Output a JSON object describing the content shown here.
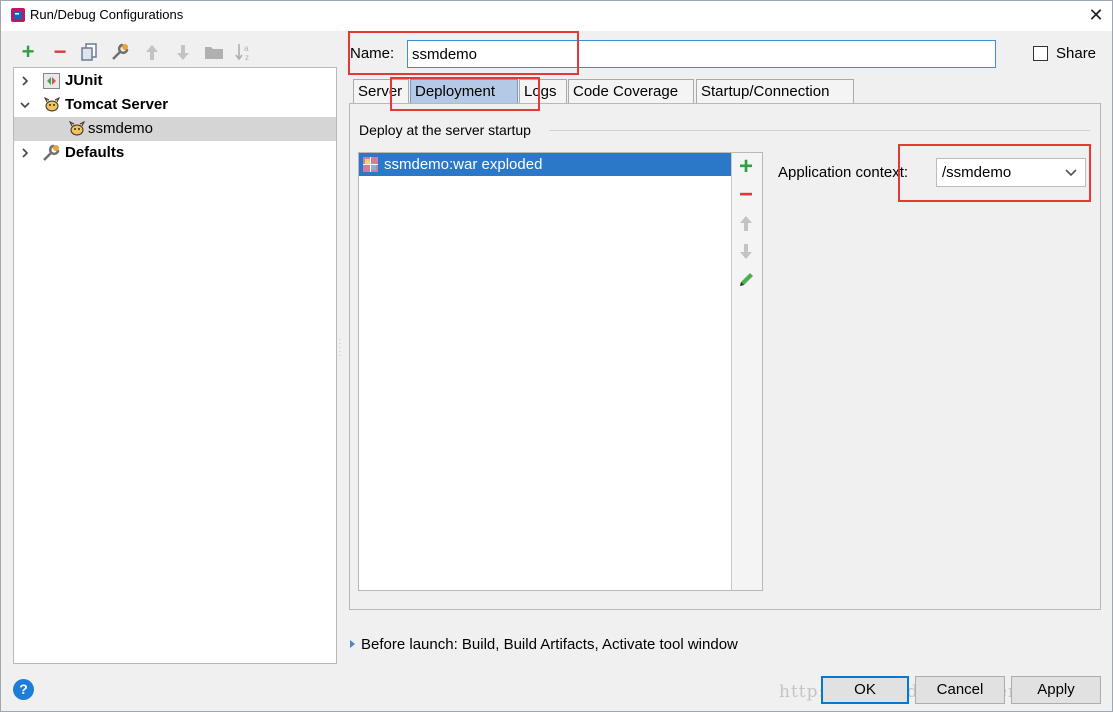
{
  "window": {
    "title": "Run/Debug Configurations",
    "close_glyph": "✕"
  },
  "toolbar": {
    "buttons": [
      {
        "name": "add-icon",
        "glyph": "+",
        "color": "#2ea043"
      },
      {
        "name": "remove-icon",
        "glyph": "−",
        "color": "#e0383e"
      },
      {
        "name": "copy-icon",
        "glyph": "⧉",
        "color": "#7a8aa0"
      },
      {
        "name": "wrench-icon",
        "glyph": "🔧",
        "color": "#777"
      },
      {
        "name": "move-up-icon",
        "glyph": "⬆",
        "color": "#b8b8b8"
      },
      {
        "name": "move-down-icon",
        "glyph": "⬇",
        "color": "#b8b8b8"
      },
      {
        "name": "folder-icon",
        "glyph": "▬",
        "color": "#a8a8a8"
      },
      {
        "name": "sort-icon",
        "glyph": "↓ᵃᶻ",
        "color": "#a8a8a8"
      }
    ]
  },
  "tree": {
    "items": [
      {
        "label": "JUnit",
        "bold": true,
        "expanded": false,
        "icon": "junit-icon"
      },
      {
        "label": "Tomcat Server",
        "bold": true,
        "expanded": true,
        "icon": "tomcat-icon"
      },
      {
        "label": "ssmdemo",
        "bold": false,
        "selected": true,
        "icon": "tomcat-icon"
      },
      {
        "label": "Defaults",
        "bold": true,
        "expanded": false,
        "icon": "wrench-icon"
      }
    ]
  },
  "name_field": {
    "label": "Name:",
    "value": "ssmdemo"
  },
  "share": {
    "label": "Share",
    "checked": false
  },
  "tabs": [
    {
      "label": "Server",
      "active": false
    },
    {
      "label": "Deployment",
      "active": true
    },
    {
      "label": "Logs",
      "active": false
    },
    {
      "label": "Code Coverage",
      "active": false
    },
    {
      "label": "Startup/Connection",
      "active": false
    }
  ],
  "deployment": {
    "group_title": "Deploy at the server startup",
    "artifacts": [
      "ssmdemo:war exploded"
    ],
    "side_tools": [
      "add",
      "remove",
      "up",
      "down",
      "edit"
    ]
  },
  "app_context": {
    "label": "Application context:",
    "value": "/ssmdemo"
  },
  "before_launch": {
    "text": "Before launch: Build, Build Artifacts, Activate tool window"
  },
  "buttons": {
    "ok": "OK",
    "cancel": "Cancel",
    "apply": "Apply",
    "help": "?"
  },
  "watermark": "http://blog.csdn.net/chenlawa",
  "colors": {
    "accent": "#2a78c7",
    "annotation": "#e53935",
    "tab_active": "#b4c9e6"
  }
}
